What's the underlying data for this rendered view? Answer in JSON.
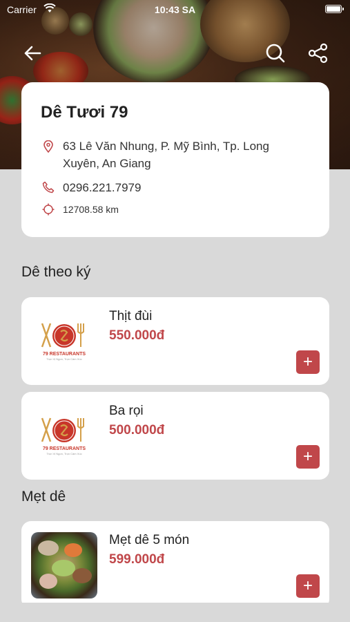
{
  "status_bar": {
    "carrier": "Carrier",
    "time": "10:43 SA"
  },
  "restaurant": {
    "name": "Dê Tươi 79",
    "address": "63 Lê Văn Nhung, P. Mỹ Bình, Tp. Long Xuyên, An Giang",
    "phone": "0296.221.7979",
    "distance": "12708.58 km"
  },
  "sections": [
    {
      "title": "Dê theo ký",
      "items": [
        {
          "name": "Thịt đùi",
          "price": "550.000đ",
          "image": "restaurant-logo"
        },
        {
          "name": "Ba rọi",
          "price": "500.000đ",
          "image": "restaurant-logo"
        }
      ]
    },
    {
      "title": "Mẹt dê",
      "items": [
        {
          "name": "Mẹt dê 5 món",
          "price": "599.000đ",
          "image": "food-photo"
        }
      ]
    }
  ],
  "logo": {
    "text": "79 RESTAURANTS",
    "tagline": "Trọn Vị Ngon, Trọn Cảm Xúc"
  },
  "icons": {
    "back": "back-arrow-icon",
    "search": "search-icon",
    "share": "share-icon",
    "add": "+"
  },
  "colors": {
    "accent": "#c0474a",
    "background": "#d9d9d9",
    "card": "#ffffff"
  }
}
